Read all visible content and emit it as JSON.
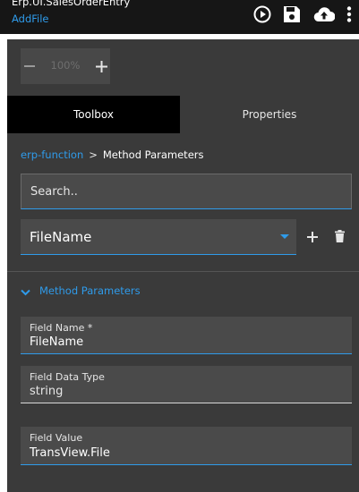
{
  "header": {
    "title": "Erp.UI.SalesOrderEntry",
    "subtitle": "AddFile",
    "icons": [
      "play-circle-icon",
      "save-icon",
      "cloud-upload-icon",
      "more-vertical-icon"
    ]
  },
  "zoom": {
    "minus": "−",
    "value": "100%",
    "plus": "+"
  },
  "tabs": {
    "toolbox": "Toolbox",
    "properties": "Properties",
    "active": "toolbox"
  },
  "breadcrumb": {
    "parent": "erp-function",
    "separator": ">",
    "current": "Method Parameters"
  },
  "search": {
    "placeholder": "Search..",
    "value": ""
  },
  "function_select": {
    "value": "FileName",
    "add_label": "+",
    "delete_icon": "trash-icon"
  },
  "section": {
    "label": "Method Parameters",
    "expanded": true
  },
  "fields": [
    {
      "label": "Field Name *",
      "value": "FileName"
    },
    {
      "label": "Field Data Type",
      "value": "string"
    },
    {
      "label": "Field Value",
      "value": "TransView.File"
    }
  ],
  "colors": {
    "accent": "#2f9bea",
    "panel": "#3a3a3a",
    "topbar": "#161616",
    "input": "#4a4a4a"
  }
}
